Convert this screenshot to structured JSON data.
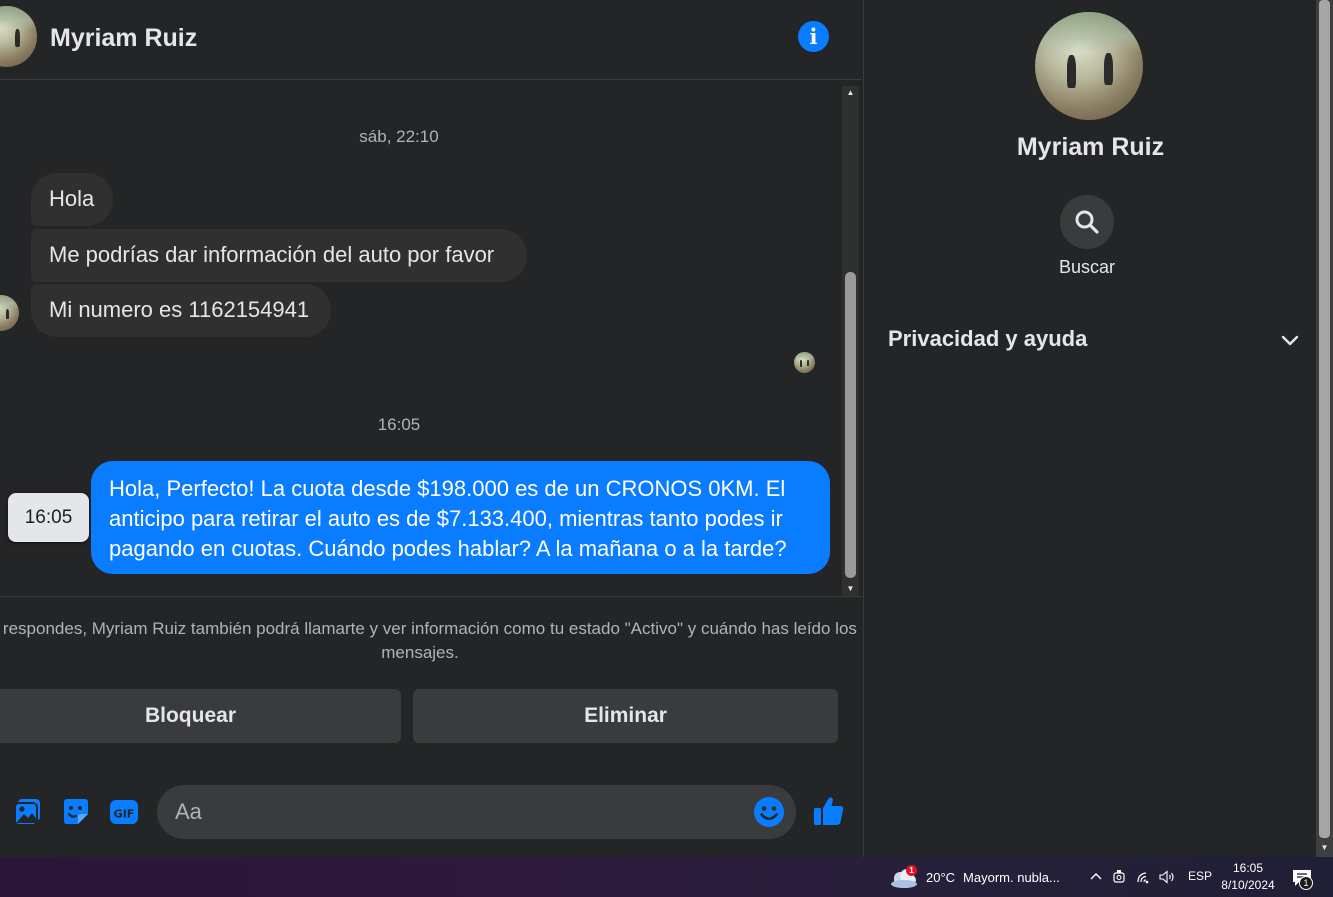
{
  "conversation": {
    "contact_name": "Myriam Ruiz",
    "info_icon": "info-icon"
  },
  "messages": {
    "timestamp_1": "sáb, 22:10",
    "incoming": [
      "Hola",
      "Me podrías dar información del auto por favor",
      "Mi numero es 1162154941"
    ],
    "timestamp_2": "16:05",
    "outgoing": "Hola, Perfecto! La cuota desde $198.000 es de un CRONOS 0KM. El anticipo para retirar el auto es de $7.133.400, mientras tanto podes ir pagando en cuotas. Cuándo podes hablar? A la mañana o a la tarde?",
    "hover_time": "16:05"
  },
  "request_notice": "Si respondes, Myriam Ruiz también podrá llamarte y ver información como tu estado \"Activo\" y cuándo has leído los mensajes.",
  "actions": {
    "block_label": "Bloquear",
    "delete_label": "Eliminar"
  },
  "composer": {
    "placeholder": "Aa",
    "icons": [
      "photo-icon",
      "sticker-icon",
      "gif-icon",
      "emoji-icon",
      "like-icon"
    ]
  },
  "side_panel": {
    "name": "Myriam Ruiz",
    "search_label": "Buscar",
    "privacy_label": "Privacidad y ayuda"
  },
  "taskbar": {
    "weather_temp": "20°C",
    "weather_text": "Mayorm. nubla...",
    "weather_badge": "1",
    "language": "ESP",
    "time": "16:05",
    "date": "8/10/2024",
    "notification_count": "1"
  },
  "colors": {
    "accent": "#0a7cff",
    "background": "#242526",
    "bubble_incoming": "#303030",
    "button": "#3a3b3c"
  }
}
